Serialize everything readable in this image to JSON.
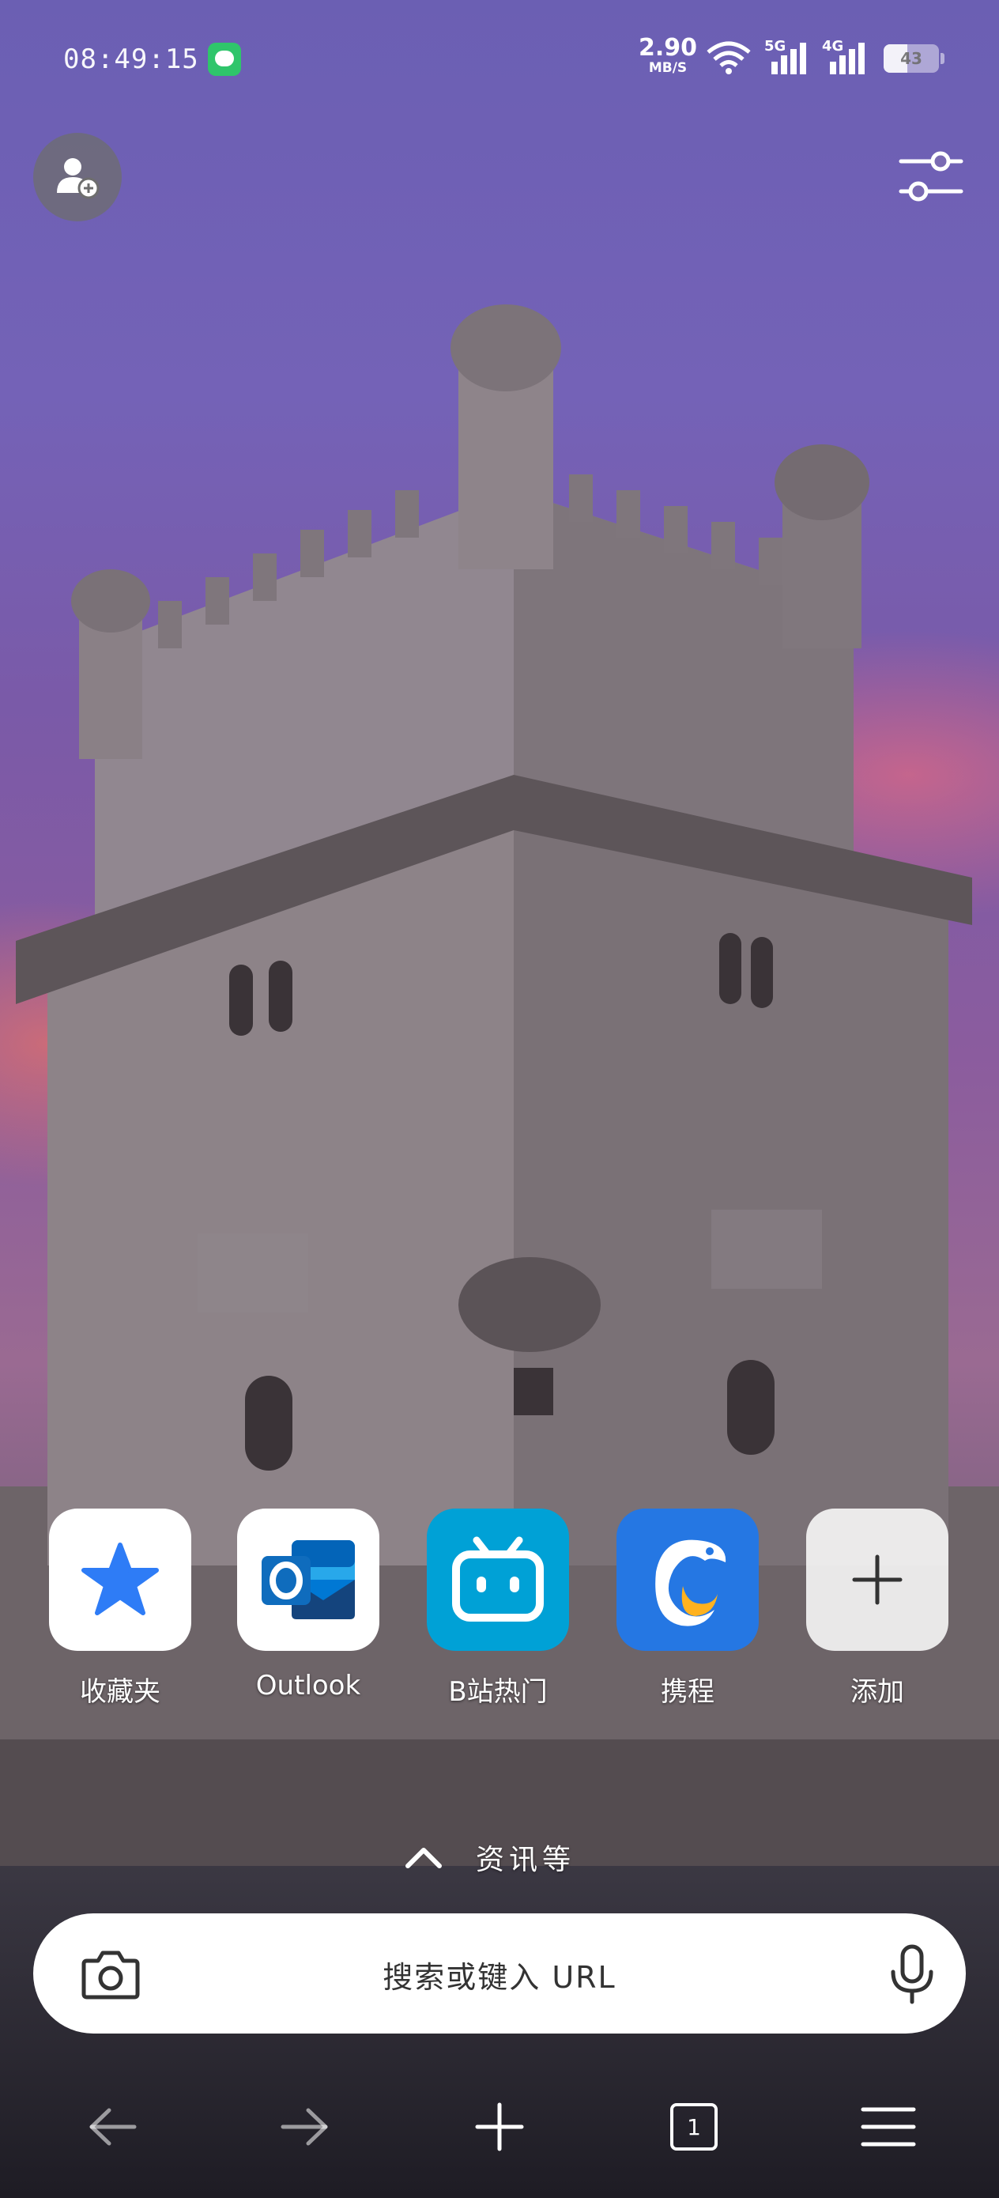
{
  "status_bar": {
    "time": "08:49:15",
    "net_speed_value": "2.90",
    "net_speed_unit": "MB/S",
    "network_labels": [
      "5G",
      "4G"
    ],
    "battery_level": "43",
    "battery_fraction": 0.43
  },
  "header": {
    "account_icon": "add-user-icon",
    "settings_icon": "sliders-icon"
  },
  "shortcuts": [
    {
      "label": "收藏夹",
      "icon": "star-icon",
      "color": "#2e7cf6"
    },
    {
      "label": "Outlook",
      "icon": "outlook-icon",
      "color": "#0f6cbd"
    },
    {
      "label": "B站热门",
      "icon": "bilibili-icon",
      "color": "#00a1d6"
    },
    {
      "label": "携程",
      "icon": "ctrip-dolphin-icon",
      "color": "#2577e3"
    },
    {
      "label": "添加",
      "icon": "plus-icon",
      "color": "#ffffff"
    }
  ],
  "news_toggle": {
    "label": "资讯等",
    "icon": "chevron-up-icon"
  },
  "search": {
    "placeholder": "搜索或键入 URL",
    "camera_icon": "camera-icon",
    "mic_icon": "microphone-icon"
  },
  "bottom_nav": {
    "back_icon": "arrow-left-icon",
    "forward_icon": "arrow-right-icon",
    "new_tab_icon": "plus-icon",
    "tabs_count": "1",
    "menu_icon": "menu-icon"
  }
}
